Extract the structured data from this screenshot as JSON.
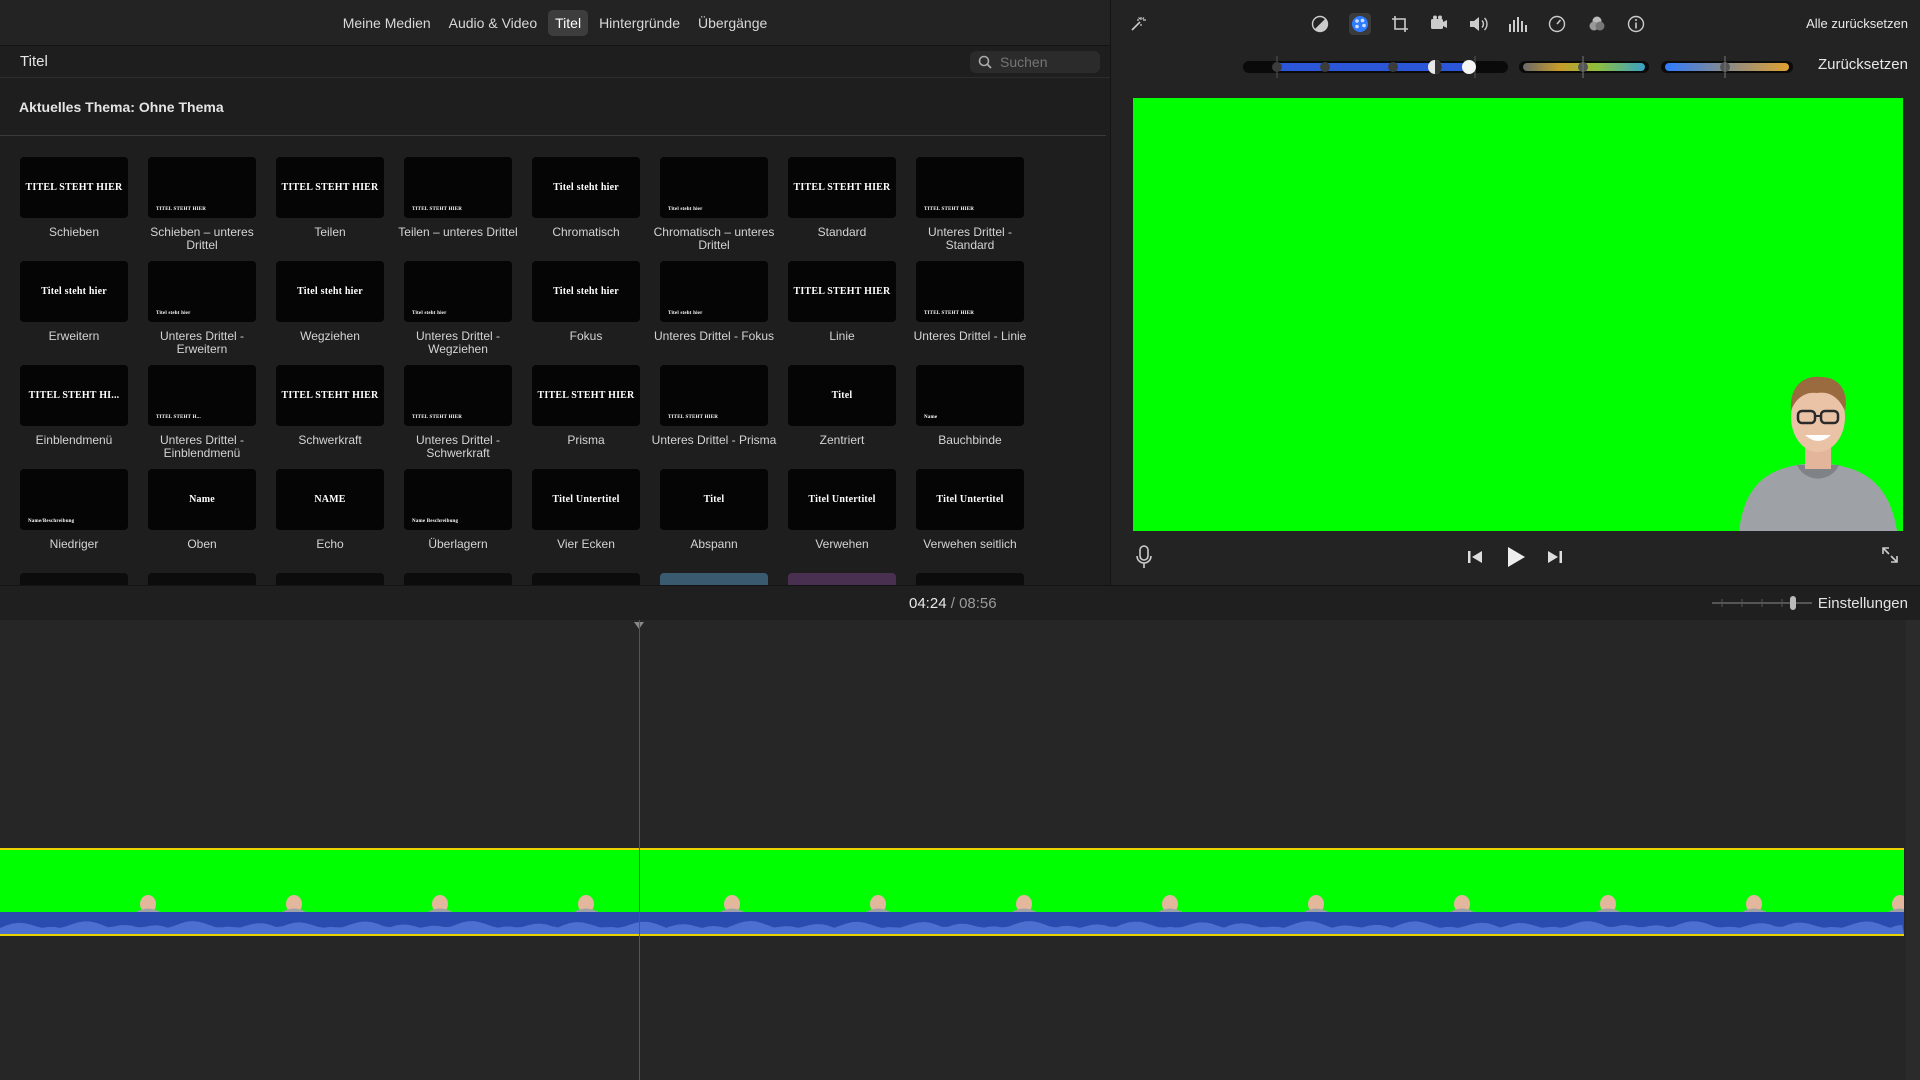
{
  "browser": {
    "tabs": [
      "Meine Medien",
      "Audio & Video",
      "Titel",
      "Hintergründe",
      "Übergänge"
    ],
    "active_tab": "Titel",
    "title": "Titel",
    "search_placeholder": "Suchen",
    "theme_label": "Aktuelles Thema: Ohne Thema",
    "titles": [
      {
        "label": "Schieben",
        "thumb": "TITEL STEHT HIER"
      },
      {
        "label": "Schieben – unteres Drittel",
        "thumb": "TITEL STEHT HIER"
      },
      {
        "label": "Teilen",
        "thumb": "TITEL STEHT HIER"
      },
      {
        "label": "Teilen – unteres Drittel",
        "thumb": "TITEL STEHT HIER"
      },
      {
        "label": "Chromatisch",
        "thumb": "Titel steht hier"
      },
      {
        "label": "Chromatisch – unteres Drittel",
        "thumb": "Titel steht hier"
      },
      {
        "label": "Standard",
        "thumb": "TITEL STEHT HIER"
      },
      {
        "label": "Unteres Drittel - Standard",
        "thumb": "TITEL STEHT HIER"
      },
      {
        "label": "Erweitern",
        "thumb": "Titel steht hier"
      },
      {
        "label": "Unteres Drittel - Erweitern",
        "thumb": "Titel steht hier"
      },
      {
        "label": "Wegziehen",
        "thumb": "Titel steht hier"
      },
      {
        "label": "Unteres Drittel - Wegziehen",
        "thumb": "Titel steht hier"
      },
      {
        "label": "Fokus",
        "thumb": "Titel steht hier"
      },
      {
        "label": "Unteres Drittel - Fokus",
        "thumb": "Titel steht hier"
      },
      {
        "label": "Linie",
        "thumb": "TITEL STEHT HIER"
      },
      {
        "label": "Unteres Drittel - Linie",
        "thumb": "TITEL STEHT HIER"
      },
      {
        "label": "Einblendmenü",
        "thumb": "TITEL STEHT HI..."
      },
      {
        "label": "Unteres Drittel - Einblendmenü",
        "thumb": "TITEL STEHT H..."
      },
      {
        "label": "Schwerkraft",
        "thumb": "TITEL STEHT HIER"
      },
      {
        "label": "Unteres Drittel - Schwerkraft",
        "thumb": "TITEL STEHT HIER"
      },
      {
        "label": "Prisma",
        "thumb": "TITEL STEHT HIER"
      },
      {
        "label": "Unteres Drittel - Prisma",
        "thumb": "TITEL STEHT HIER"
      },
      {
        "label": "Zentriert",
        "thumb": "Titel"
      },
      {
        "label": "Bauchbinde",
        "thumb": "Name"
      },
      {
        "label": "Niedriger",
        "thumb": "Name/Beschreibung"
      },
      {
        "label": "Oben",
        "thumb": "Name"
      },
      {
        "label": "Echo",
        "thumb": "NAME"
      },
      {
        "label": "Überlagern",
        "thumb": "Name Beschreibung"
      },
      {
        "label": "Vier Ecken",
        "thumb": "Titel Untertitel"
      },
      {
        "label": "Abspann",
        "thumb": "Titel"
      },
      {
        "label": "Verwehen",
        "thumb": "Titel Untertitel"
      },
      {
        "label": "Verwehen seitlich",
        "thumb": "Titel Untertitel"
      }
    ]
  },
  "viewer": {
    "reset_all": "Alle zurücksetzen",
    "reset": "Zurücksetzen",
    "tools": [
      "magic-wand-icon",
      "color-balance-icon",
      "color-correction-icon",
      "crop-icon",
      "stabilization-icon",
      "volume-icon",
      "equalizer-icon",
      "speed-icon",
      "filter-icon",
      "info-icon"
    ],
    "active_tool": "color-correction-icon"
  },
  "timeline": {
    "current_time": "04:24",
    "separator": "/",
    "total_time": "08:56",
    "settings_label": "Einstellungen"
  },
  "colors": {
    "chroma_green": "#00ff00",
    "clip_border": "#e8d200",
    "audio_blue": "#2a4bb0",
    "accent_blue": "#2f7bff"
  }
}
